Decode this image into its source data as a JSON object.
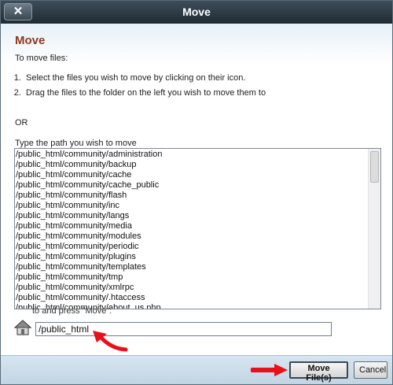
{
  "window": {
    "title": "Move",
    "close_label": "✕"
  },
  "content": {
    "heading": "Move",
    "intro": "To move files:",
    "steps": [
      "Select the files you wish to move by clicking on their icon.",
      "Drag the files to the folder on the left you wish to move them to"
    ],
    "or_label": "OR",
    "type_label": "Type the path you wish to move",
    "paths": [
      "/public_html/community/administration",
      "/public_html/community/backup",
      "/public_html/community/cache",
      "/public_html/community/cache_public",
      "/public_html/community/flash",
      "/public_html/community/inc",
      "/public_html/community/langs",
      "/public_html/community/media",
      "/public_html/community/modules",
      "/public_html/community/periodic",
      "/public_html/community/plugins",
      "/public_html/community/templates",
      "/public_html/community/tmp",
      "/public_html/community/xmlrpc",
      "/public_html/community/.htaccess",
      "/public_html/community/about_us.php"
    ],
    "press_label": "to and press \"Move\":",
    "path_value": "/public_html",
    "home_icon": "home-icon"
  },
  "footer": {
    "move_label": "Move File(s)",
    "cancel_label": "Cancel"
  },
  "colors": {
    "heading": "#8b3a1a",
    "arrow": "#e8101a",
    "titlebar": "#2a3740"
  }
}
